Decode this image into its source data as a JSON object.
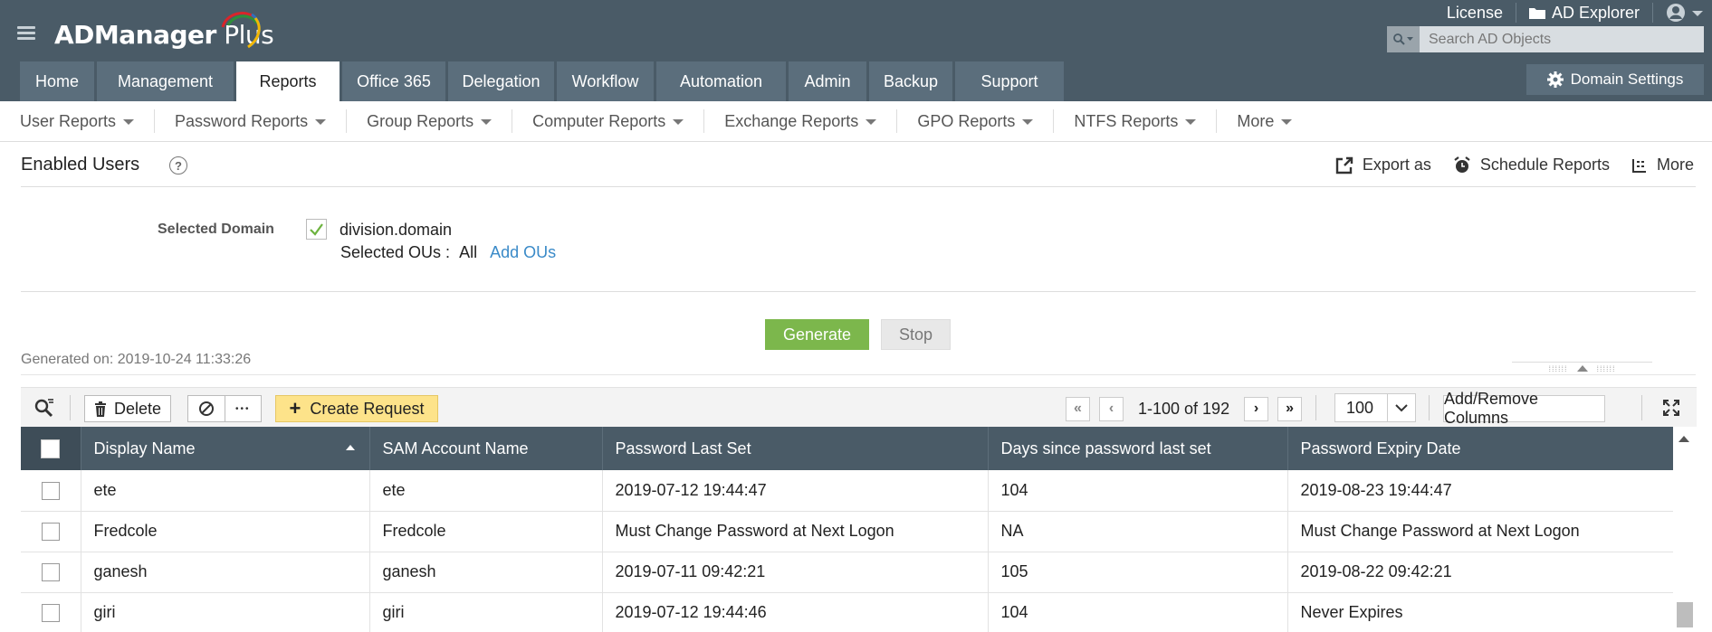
{
  "header": {
    "logo_text_bold": "ADManager",
    "logo_text_light": " Plus",
    "top_links": [
      {
        "label": "License",
        "icon": "none"
      },
      {
        "label": "AD Explorer",
        "icon": "folder-icon"
      },
      {
        "label": "",
        "icon": "user-icon"
      }
    ],
    "search_placeholder": "Search AD Objects",
    "tabs": [
      {
        "label": "Home",
        "active": false
      },
      {
        "label": "Management",
        "active": false
      },
      {
        "label": "Reports",
        "active": true
      },
      {
        "label": "Office 365",
        "active": false
      },
      {
        "label": "Delegation",
        "active": false
      },
      {
        "label": "Workflow",
        "active": false
      },
      {
        "label": "Automation",
        "active": false
      },
      {
        "label": "Admin",
        "active": false
      },
      {
        "label": "Backup",
        "active": false
      },
      {
        "label": "Support",
        "active": false
      }
    ],
    "domain_settings_label": "Domain Settings"
  },
  "subnav": {
    "items": [
      "User Reports",
      "Password Reports",
      "Group Reports",
      "Computer Reports",
      "Exchange Reports",
      "GPO Reports",
      "NTFS Reports",
      "More"
    ]
  },
  "report": {
    "title": "Enabled Users",
    "help": "?",
    "actions": {
      "export": "Export as",
      "schedule": "Schedule Reports",
      "more": "More"
    },
    "selected_domain_label": "Selected Domain",
    "domain_name": "division.domain",
    "domain_checked": true,
    "selected_ous_label": "Selected OUs :",
    "selected_ous_value": "All",
    "add_ous_link": "Add OUs",
    "generate_label": "Generate",
    "stop_label": "Stop",
    "generated_on": "Generated on: 2019-10-24 11:33:26"
  },
  "toolbar": {
    "delete_label": "Delete",
    "more_dots": "•••",
    "create_request_label": "Create Request",
    "pager_text": "1-100 of 192",
    "per_page": "100",
    "add_remove_columns_label": "Add/Remove Columns"
  },
  "table": {
    "columns": [
      "Display Name",
      "SAM Account Name",
      "Password Last Set",
      "Days since password last set",
      "Password Expiry Date"
    ],
    "sorted_column": "Display Name",
    "sort_direction": "ascending",
    "rows": [
      [
        "ete",
        "ete",
        "2019-07-12 19:44:47",
        "104",
        "2019-08-23 19:44:47"
      ],
      [
        "Fredcole",
        "Fredcole",
        "Must Change Password at Next Logon",
        "NA",
        "Must Change Password at Next Logon"
      ],
      [
        "ganesh",
        "ganesh",
        "2019-07-11 09:42:21",
        "105",
        "2019-08-22 09:42:21"
      ],
      [
        "giri",
        "giri",
        "2019-07-12 19:44:46",
        "104",
        "Never Expires"
      ]
    ]
  },
  "colors": {
    "header_bg": "#4a5b67",
    "tab_bg": "#5b6e7c",
    "generate_green": "#7cb74c",
    "create_request_yellow": "#fde38a",
    "link_blue": "#3a8ac8"
  }
}
